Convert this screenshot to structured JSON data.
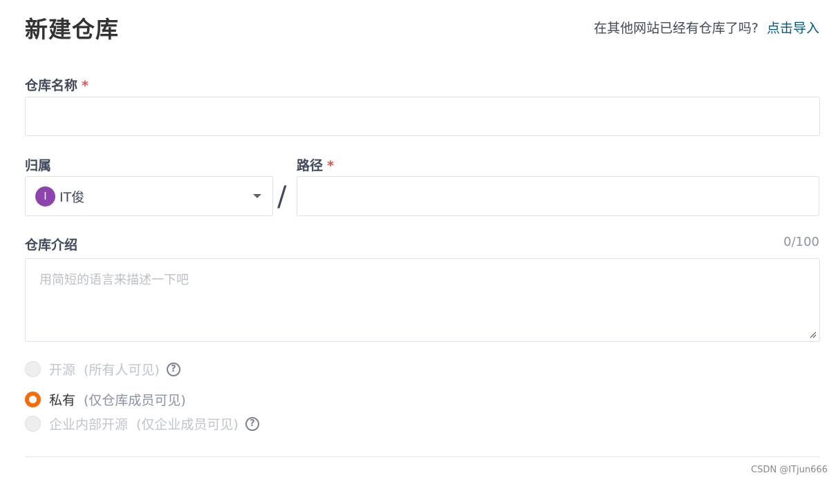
{
  "page_title": "新建仓库",
  "import": {
    "question": "在其他网站已经有仓库了吗?",
    "link": "点击导入"
  },
  "repo_name": {
    "label": "仓库名称",
    "required_mark": "*",
    "value": ""
  },
  "owner": {
    "label": "归属",
    "avatar_letter": "I",
    "avatar_color": "#8e44ad",
    "name": "IT俊"
  },
  "path": {
    "label": "路径",
    "required_mark": "*",
    "separator": "/",
    "value": ""
  },
  "description": {
    "label": "仓库介绍",
    "counter": "0/100",
    "placeholder": "用简短的语言来描述一下吧",
    "value": ""
  },
  "visibility": {
    "options": [
      {
        "label": "开源",
        "note": "(所有人可见)",
        "state": "disabled",
        "has_help": true
      },
      {
        "label": "私有",
        "note": "(仅仓库成员可见)",
        "state": "checked",
        "has_help": false
      },
      {
        "label": "企业内部开源",
        "note": "(仅企业成员可见)",
        "state": "disabled",
        "has_help": true
      }
    ],
    "help_glyph": "?"
  },
  "watermark": "CSDN @ITjun666",
  "colors": {
    "accent": "#f56c08",
    "link": "#005980",
    "required": "#e94d4d"
  }
}
